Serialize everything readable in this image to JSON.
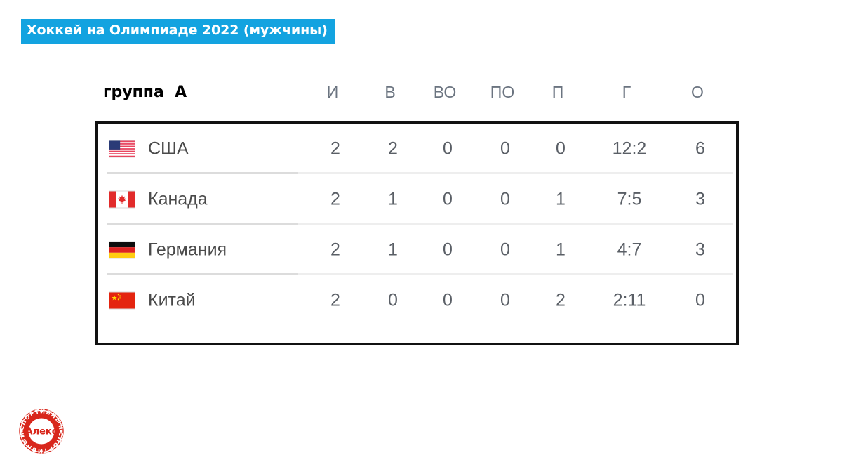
{
  "banner": {
    "title": "Хоккей на Олимпиаде 2022 (мужчины)",
    "background_color": "#13A3E0",
    "text_color": "#FFFFFF"
  },
  "table": {
    "group_label": "группа  А",
    "columns": [
      {
        "key": "games",
        "label": "И"
      },
      {
        "key": "wins",
        "label": "В"
      },
      {
        "key": "ot_wins",
        "label": "ВО"
      },
      {
        "key": "ot_losses",
        "label": "ПО"
      },
      {
        "key": "losses",
        "label": "П"
      },
      {
        "key": "goals",
        "label": "Г"
      },
      {
        "key": "points",
        "label": "О"
      }
    ],
    "rows": [
      {
        "flag": "flag-usa",
        "team": "США",
        "games": "2",
        "wins": "2",
        "ot_wins": "0",
        "ot_losses": "0",
        "losses": "0",
        "goals": "12:2",
        "points": "6"
      },
      {
        "flag": "flag-canada",
        "team": "Канада",
        "games": "2",
        "wins": "1",
        "ot_wins": "0",
        "ot_losses": "0",
        "losses": "1",
        "goals": "7:5",
        "points": "3"
      },
      {
        "flag": "flag-germany",
        "team": "Германия",
        "games": "2",
        "wins": "1",
        "ot_wins": "0",
        "ot_losses": "0",
        "losses": "1",
        "goals": "4:7",
        "points": "3"
      },
      {
        "flag": "flag-china",
        "team": "Китай",
        "games": "2",
        "wins": "0",
        "ot_wins": "0",
        "ot_losses": "0",
        "losses": "2",
        "goals": "2:11",
        "points": "0"
      }
    ],
    "border_color": "#111111",
    "header_text_color": "#6B7480",
    "cell_text_color": "#5A5F66"
  },
  "watermark": {
    "center_text": "Алекс",
    "ring_text": "СПОРТИВНЫЙ",
    "color": "#D8271C"
  }
}
